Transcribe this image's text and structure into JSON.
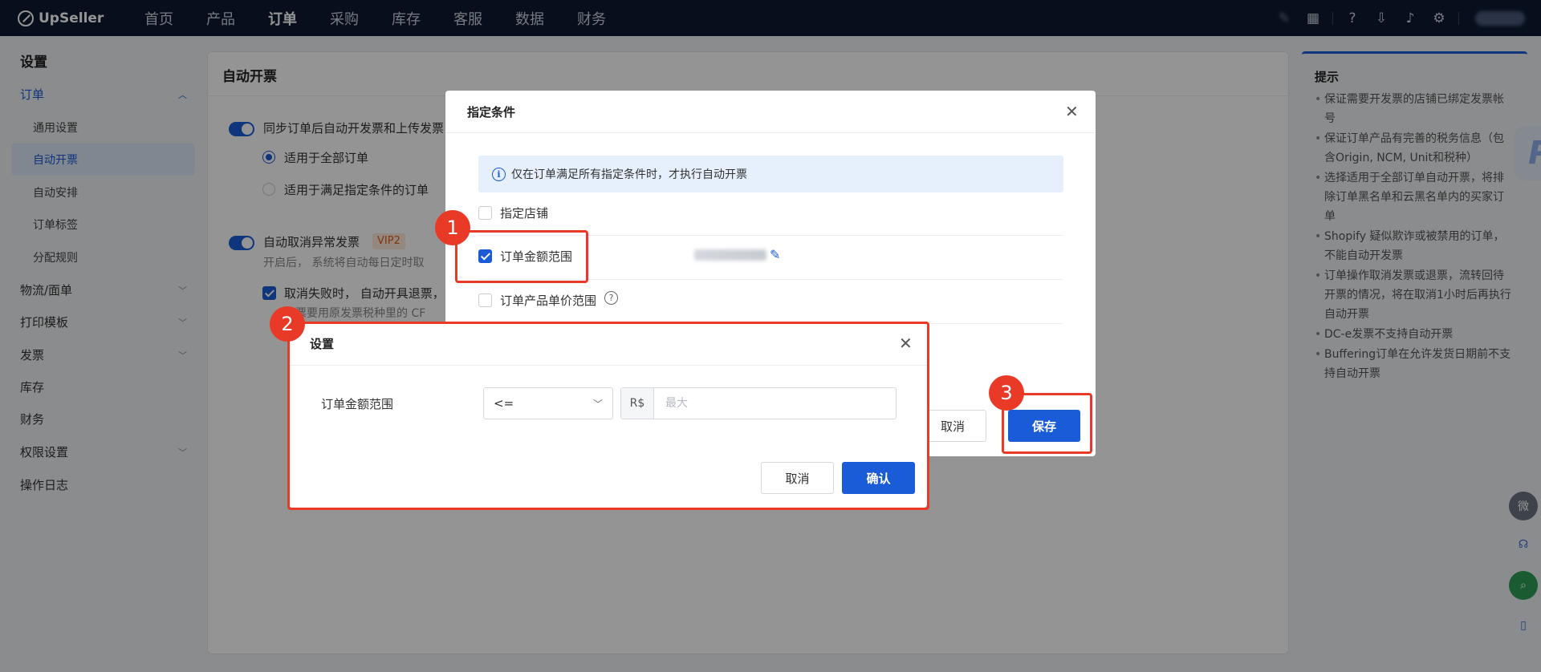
{
  "app": {
    "brand": "UpSeller"
  },
  "nav": {
    "items": [
      "首页",
      "产品",
      "订单",
      "采购",
      "库存",
      "客服",
      "数据",
      "财务"
    ],
    "active_index": 2
  },
  "sidebar": {
    "title": "设置",
    "groups": {
      "order": "订单",
      "order_subs": [
        "通用设置",
        "自动开票",
        "自动安排",
        "订单标签",
        "分配规则"
      ],
      "logistics": "物流/面单",
      "print": "打印模板",
      "invoice": "发票",
      "stock": "库存",
      "finance": "财务",
      "permission": "权限设置",
      "log": "操作日志"
    }
  },
  "main": {
    "title": "自动开票",
    "toggle1_label": "同步订单后自动开发票和上传发票",
    "radio_all": "适用于全部订单",
    "radio_cond": "适用于满足指定条件的订单",
    "toggle2_label": "自动取消异常发票",
    "vip_badge": "VIP2",
    "toggle2_desc": "开启后， 系统将自动每日定时取",
    "cb_label": "取消失败时， 自动开具退票，",
    "cb_desc": "退票要用原发票税种里的 CF"
  },
  "tips": {
    "title": "提示",
    "items": [
      "保证需要开发票的店铺已绑定发票帐号",
      "保证订单产品有完善的税务信息（包含Origin, NCM, Unit和税种）",
      "选择适用于全部订单自动开票，将排除订单黑名单和云黑名单内的买家订单",
      "Shopify 疑似欺诈或被禁用的订单，不能自动开发票",
      "订单操作取消发票或退票，流转回待开票的情况，将在取消1小时后再执行自动开票",
      "DC-e发票不支持自动开票",
      "Buffering订单在允许发货日期前不支持自动开票"
    ]
  },
  "float_buttons": {
    "wechat": "微"
  },
  "dialog_conditions": {
    "title": "指定条件",
    "info": "仅在订单满足所有指定条件时，才执行自动开票",
    "cond_store": "指定店铺",
    "cond_amount": "订单金额范围",
    "cond_unit_price": "订单产品单价范围",
    "cancel_label": "取消",
    "save_label": "保存"
  },
  "dialog_settings": {
    "title": "设置",
    "field_label": "订单金额范围",
    "operator": "<=",
    "currency": "R$",
    "max_placeholder": "最大",
    "max_value": "",
    "cancel_label": "取消",
    "confirm_label": "确认"
  },
  "annotations": [
    "1",
    "2",
    "3"
  ],
  "colors": {
    "primary": "#1a5cd8",
    "nav_bg": "#0d1a33",
    "highlight": "#e83a26",
    "vip": "#e25c1c"
  }
}
